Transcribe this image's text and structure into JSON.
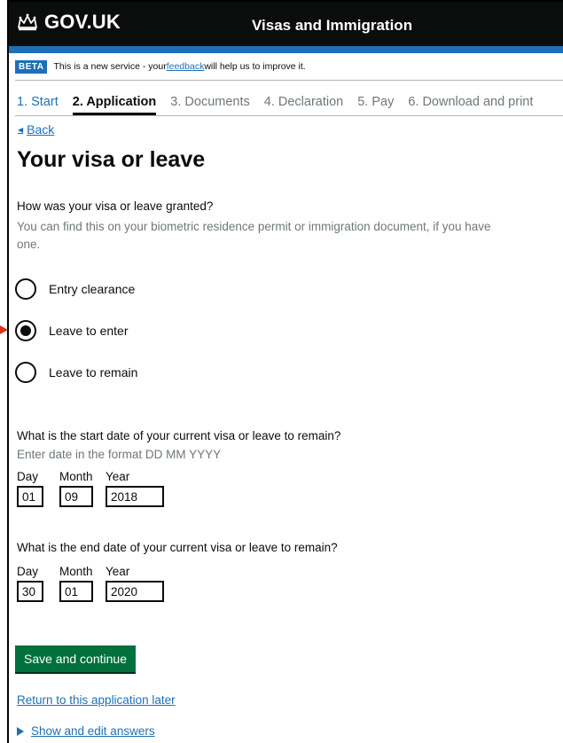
{
  "header": {
    "brand": "GOV.UK",
    "service_name": "Visas and Immigration"
  },
  "beta_banner": {
    "tag": "BETA",
    "text_before": "This is a new service - your ",
    "link": "feedback",
    "text_after": " will help us to improve it."
  },
  "steps": [
    {
      "label": "1. Start",
      "state": "link"
    },
    {
      "label": "2. Application",
      "state": "active"
    },
    {
      "label": "3. Documents",
      "state": "inactive"
    },
    {
      "label": "4. Declaration",
      "state": "inactive"
    },
    {
      "label": "5. Pay",
      "state": "inactive"
    },
    {
      "label": "6. Download and print",
      "state": "inactive"
    }
  ],
  "back_link": "Back",
  "page_title": "Your visa or leave",
  "grant_question": {
    "label": "How was your visa or leave granted?",
    "hint": "You can find this on your biometric residence permit or immigration document, if you have one.",
    "options": [
      {
        "label": "Entry clearance",
        "checked": false
      },
      {
        "label": "Leave to enter",
        "checked": true
      },
      {
        "label": "Leave to remain",
        "checked": false
      }
    ]
  },
  "start_date": {
    "label": "What is the start date of your current visa or leave to remain?",
    "hint": "Enter date in the format DD MM YYYY",
    "day_label": "Day",
    "month_label": "Month",
    "year_label": "Year",
    "day": "01",
    "month": "09",
    "year": "2018"
  },
  "end_date": {
    "label": "What is the end date of your current visa or leave to remain?",
    "day_label": "Day",
    "month_label": "Month",
    "year_label": "Year",
    "day": "30",
    "month": "01",
    "year": "2020"
  },
  "save_button": "Save and continue",
  "return_link": "Return to this application later",
  "details_link": "Show and edit answers",
  "colors": {
    "header_bg": "#0b0c0c",
    "brand_blue": "#1d70b8",
    "button_green": "#00703c",
    "hint_grey": "#6f777b",
    "marker_red": "#d4351c"
  },
  "icons": {
    "crown": "crown-icon",
    "back": "back-arrow-icon",
    "details": "triangle-right-icon",
    "marker": "red-arrow-marker-icon"
  }
}
